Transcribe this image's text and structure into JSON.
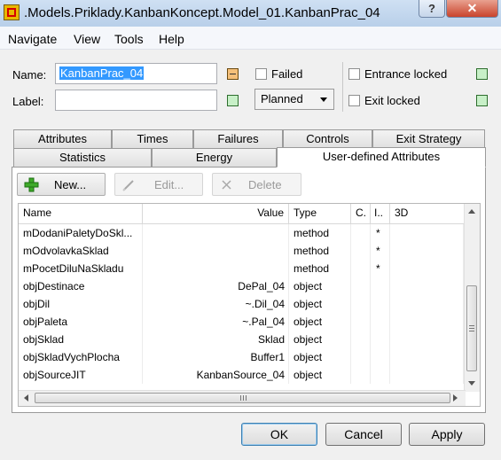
{
  "window": {
    "title": ".Models.Priklady.KanbanKoncept.Model_01.KanbanPrac_04"
  },
  "menu": [
    "Navigate",
    "View",
    "Tools",
    "Help"
  ],
  "form": {
    "name_label": "Name:",
    "name_value": "KanbanPrac_04",
    "label_label": "Label:",
    "label_value": "",
    "failed_label": "Failed",
    "status_value": "Planned",
    "entrance_locked_label": "Entrance locked",
    "exit_locked_label": "Exit locked"
  },
  "tabs_row1": [
    "Attributes",
    "Times",
    "Failures",
    "Controls",
    "Exit Strategy"
  ],
  "tabs_row2": [
    "Statistics",
    "Energy",
    "User-defined Attributes"
  ],
  "toolbar": {
    "new_label": "New...",
    "edit_label": "Edit...",
    "delete_label": "Delete"
  },
  "table": {
    "columns": [
      "Name",
      "Value",
      "Type",
      "C.",
      "I..",
      "3D"
    ],
    "rows": [
      {
        "name": "mDodaniPaletyDoSkl...",
        "value": "",
        "type": "method",
        "c": "",
        "i": "*",
        "d3": ""
      },
      {
        "name": "mOdvolavkaSklad",
        "value": "",
        "type": "method",
        "c": "",
        "i": "*",
        "d3": ""
      },
      {
        "name": "mPocetDiluNaSkladu",
        "value": "",
        "type": "method",
        "c": "",
        "i": "*",
        "d3": ""
      },
      {
        "name": "objDestinace",
        "value": "DePal_04",
        "type": "object",
        "c": "",
        "i": "",
        "d3": ""
      },
      {
        "name": "objDil",
        "value": "~.Dil_04",
        "type": "object",
        "c": "",
        "i": "",
        "d3": ""
      },
      {
        "name": "objPaleta",
        "value": "~.Pal_04",
        "type": "object",
        "c": "",
        "i": "",
        "d3": ""
      },
      {
        "name": "objSklad",
        "value": "Sklad",
        "type": "object",
        "c": "",
        "i": "",
        "d3": ""
      },
      {
        "name": "objSkladVychPlocha",
        "value": "Buffer1",
        "type": "object",
        "c": "",
        "i": "",
        "d3": ""
      },
      {
        "name": "objSourceJIT",
        "value": "KanbanSource_04",
        "type": "object",
        "c": "",
        "i": "",
        "d3": ""
      }
    ]
  },
  "buttons": {
    "ok": "OK",
    "cancel": "Cancel",
    "apply": "Apply"
  },
  "colors": {
    "accent_green": "#c8f0c8",
    "accent_orange": "#f5c07a",
    "selection": "#3399ff"
  }
}
